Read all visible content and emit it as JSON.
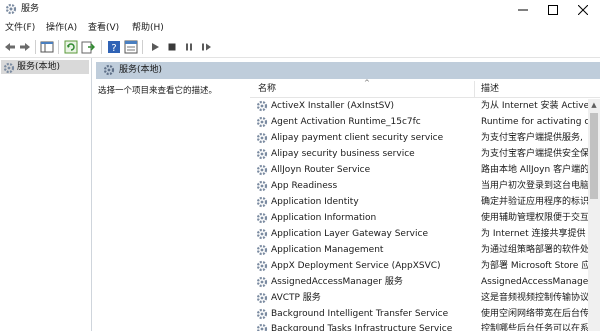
{
  "window": {
    "title": "服务",
    "minimize_glyph": "—",
    "maximize_glyph": "☐",
    "close_glyph": "✕"
  },
  "menu": [
    "文件(F)",
    "操作(A)",
    "查看(V)",
    "帮助(H)"
  ],
  "tree": {
    "item_label": "服务(本地)"
  },
  "pane": {
    "title": "服务(本地)",
    "description": "选择一个项目来查看它的描述。"
  },
  "list": {
    "col_name": "名称",
    "col_desc": "描述",
    "sort_glyph": "^",
    "rows": [
      {
        "name": "ActiveX Installer (AxInstSV)",
        "desc": "为从 Internet 安装 ActiveX"
      },
      {
        "name": "Agent Activation Runtime_15c7fc",
        "desc": "Runtime for activating co"
      },
      {
        "name": "Alipay payment client security service",
        "desc": "为支付宝客户端提供服务,"
      },
      {
        "name": "Alipay security business service",
        "desc": "为支付宝客户端提供安全保"
      },
      {
        "name": "AllJoyn Router Service",
        "desc": "路由本地 AllJoyn 客户端的"
      },
      {
        "name": "App Readiness",
        "desc": "当用户初次登录到这台电脑"
      },
      {
        "name": "Application Identity",
        "desc": "确定并验证应用程序的标识"
      },
      {
        "name": "Application Information",
        "desc": "使用辅助管理权限便于交互"
      },
      {
        "name": "Application Layer Gateway Service",
        "desc": "为 Internet 连接共享提供"
      },
      {
        "name": "Application Management",
        "desc": "为通过组策略部署的软件处"
      },
      {
        "name": "AppX Deployment Service (AppXSVC)",
        "desc": "为部署 Microsoft Store 应"
      },
      {
        "name": "AssignedAccessManager 服务",
        "desc": "AssignedAccessManager"
      },
      {
        "name": "AVCTP 服务",
        "desc": "这是音频视频控制传输协议"
      },
      {
        "name": "Background Intelligent Transfer Service",
        "desc": "使用空闲网络带宽在后台传"
      },
      {
        "name": "Background Tasks Infrastructure Service",
        "desc": "控制哪些后台任务可以在系"
      }
    ]
  },
  "colors": {
    "header_band": "#bfcddb",
    "tree_selection": "#d9d9d9",
    "gear_icon": "#7a8aa0"
  }
}
